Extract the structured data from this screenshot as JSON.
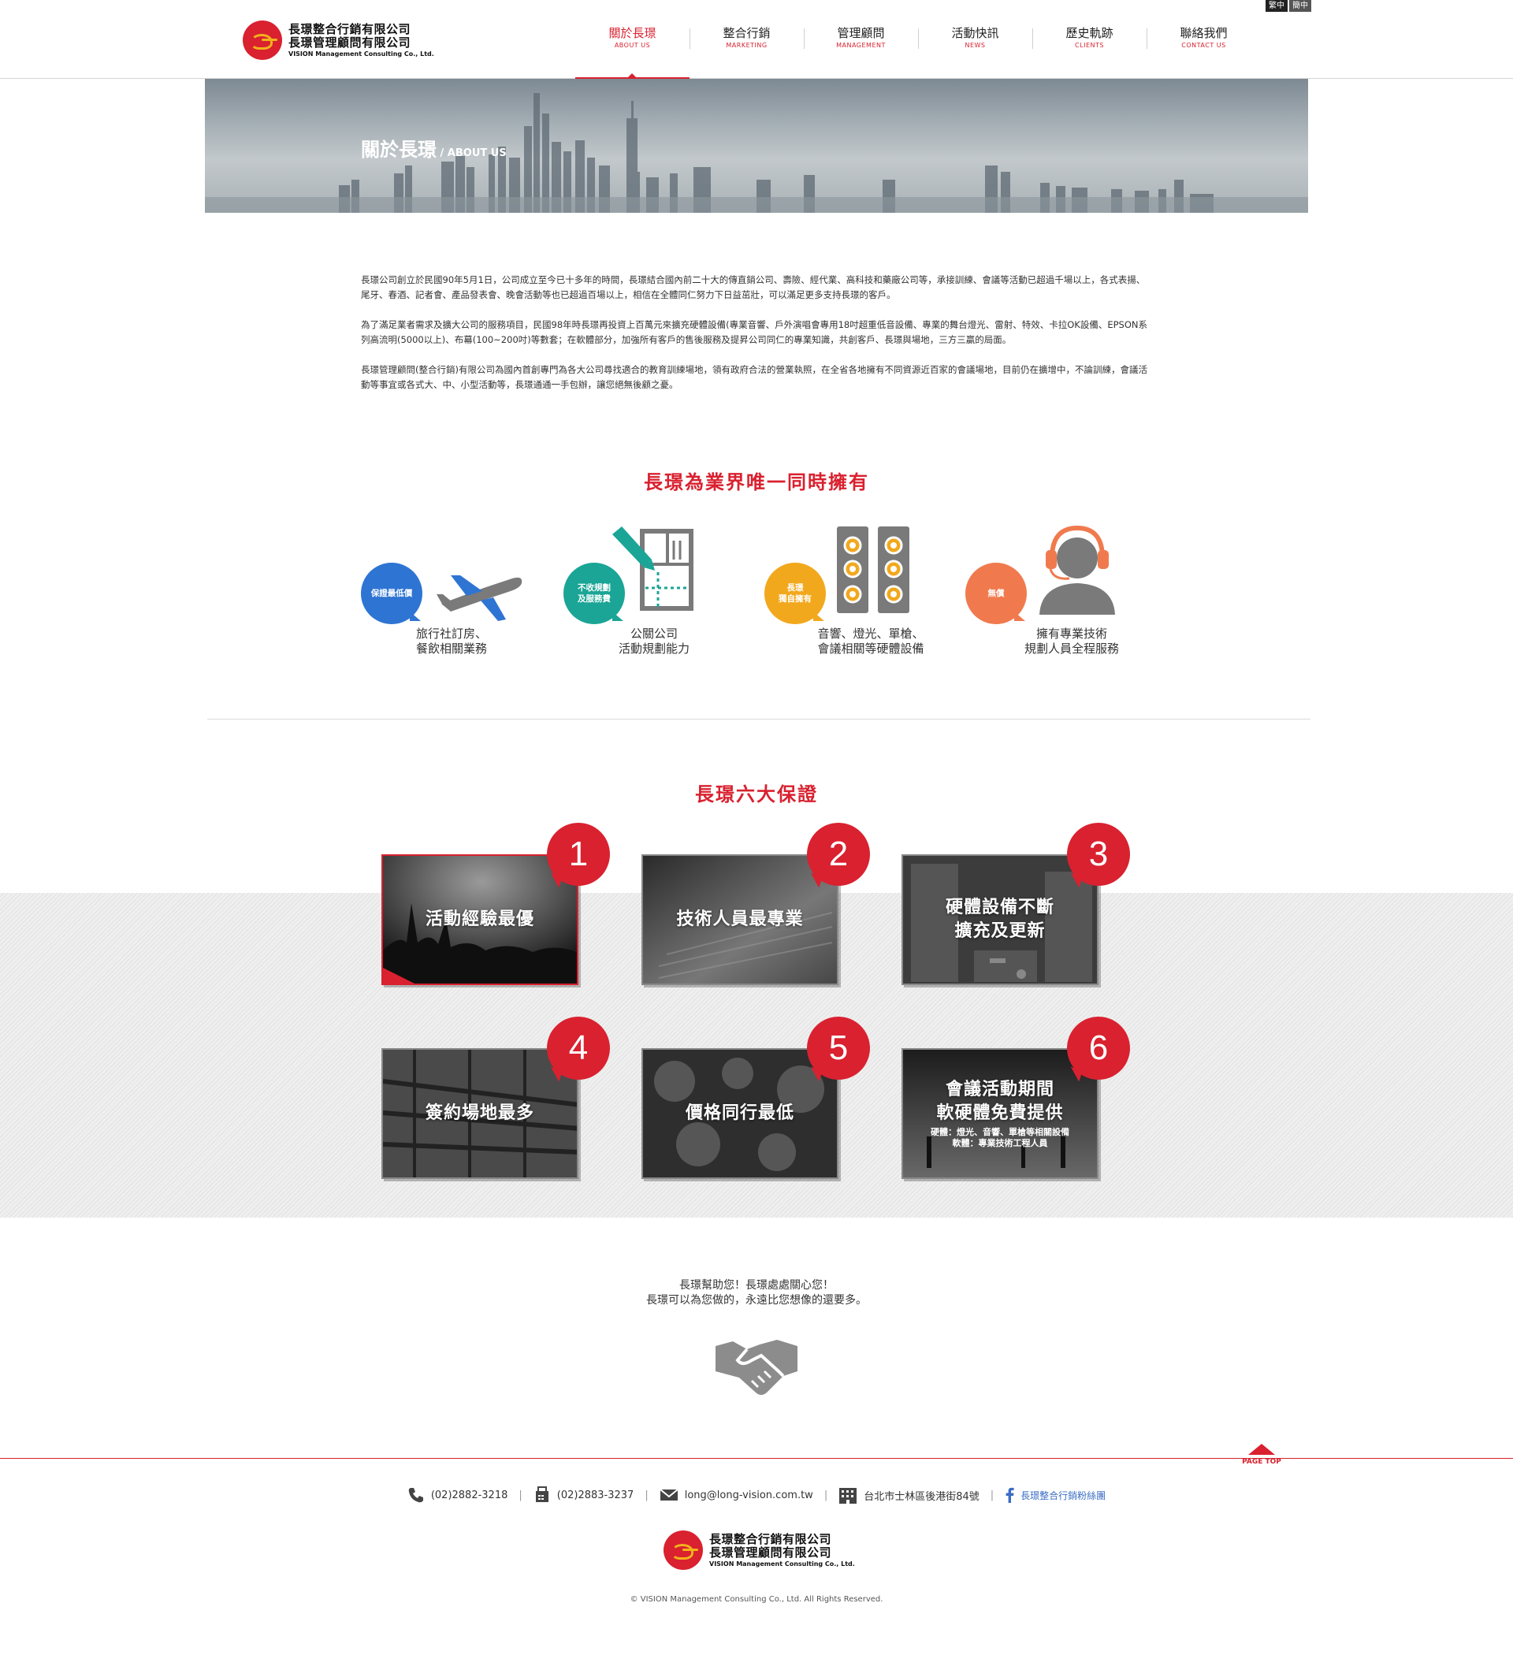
{
  "lang": [
    "繁中",
    "簡中"
  ],
  "logo": {
    "line1": "長璟整合行銷有限公司",
    "line2": "長璟管理顧問有限公司",
    "line3": "VISION Management Consulting Co., Ltd."
  },
  "nav": [
    {
      "zh": "關於長璟",
      "en": "ABOUT US"
    },
    {
      "zh": "整合行銷",
      "en": "MARKETING"
    },
    {
      "zh": "管理顧問",
      "en": "MANAGEMENT"
    },
    {
      "zh": "活動快訊",
      "en": "NEWS"
    },
    {
      "zh": "歷史軌跡",
      "en": "CLIENTS"
    },
    {
      "zh": "聯絡我們",
      "en": "CONTACT US"
    }
  ],
  "banner": {
    "zh": "關於長璟",
    "en": " / ABOUT US"
  },
  "intro": [
    "長璟公司創立於民國90年5月1日，公司成立至今已十多年的時間，長璟結合國內前二十大的傳直銷公司、壽險、經代業、高科技和藥廠公司等，承接訓練、會議等活動已超過千場以上，各式表揚、尾牙、春酒、記者會、產品發表會、晚會活動等也已超過百場以上，相信在全體同仁努力下日益茁壯，可以滿足更多支持長璟的客戶。",
    "為了滿足業者需求及擴大公司的服務項目，民國98年時長璟再投資上百萬元來擴充硬體設備(專業音響、戶外演唱會專用18吋超重低音設備、專業的舞台燈光、雷射、特效、卡拉OK設備、EPSON系列高流明(5000以上)、布幕(100~200吋)等數套；在軟體部分，加強所有客戶的售後服務及提昇公司同仁的專業知識，共創客戶、長璟與場地，三方三贏的局面。",
    "長璟管理顧問(整合行銷)有限公司為國內首創專門為各大公司尋找適合的教育訓練場地，領有政府合法的營業執照，在全省各地擁有不同資源近百家的會議場地，目前仍在擴增中，不論訓練，會議活動等事宜或各式大、中、小型活動等，長璟通通一手包辦，讓您絕無後顧之憂。"
  ],
  "features_title": "長璟為業界唯一同時擁有",
  "features": [
    {
      "badge_l1": "保證最低價",
      "badge_l2": "",
      "cap1": "旅行社訂房、",
      "cap2": "餐飲相關業務",
      "color": "#2e74d3",
      "icon": "airplane-icon"
    },
    {
      "badge_l1": "不收規劃",
      "badge_l2": "及服務費",
      "cap1": "公關公司",
      "cap2": "活動規劃能力",
      "color": "#1aa596",
      "icon": "floorplan-icon"
    },
    {
      "badge_l1": "長璟",
      "badge_l2": "獨自擁有",
      "cap1": "音響、燈光、單槍、",
      "cap2": "會議相關等硬體設備",
      "color": "#f2a81d",
      "icon": "speaker-icon"
    },
    {
      "badge_l1": "無償",
      "badge_l2": "",
      "cap1": "擁有專業技術",
      "cap2": "規劃人員全程服務",
      "color": "#f07a4e",
      "icon": "headset-person-icon"
    }
  ],
  "guarantee_title": "長璟六大保證",
  "guarantees": [
    {
      "num": "1",
      "title": "活動經驗最優",
      "title2": "",
      "sub1": "",
      "sub2": ""
    },
    {
      "num": "2",
      "title": "技術人員最專業",
      "title2": "",
      "sub1": "",
      "sub2": ""
    },
    {
      "num": "3",
      "title": "硬體設備不斷",
      "title2": "擴充及更新",
      "sub1": "",
      "sub2": ""
    },
    {
      "num": "4",
      "title": "簽約場地最多",
      "title2": "",
      "sub1": "",
      "sub2": ""
    },
    {
      "num": "5",
      "title": "價格同行最低",
      "title2": "",
      "sub1": "",
      "sub2": ""
    },
    {
      "num": "6",
      "title": "會議活動期間",
      "title2": "軟硬體免費提供",
      "sub1": "硬體：燈光、音響、單槍等相關設備",
      "sub2": "軟體：專業技術工程人員"
    }
  ],
  "closing": {
    "line1": "長璟幫助您！長璟處處關心您！",
    "line2": "長璟可以為您做的，永遠比您想像的還要多。"
  },
  "pagetop": "PAGE TOP",
  "contacts": {
    "phone": "(02)2882-3218",
    "fax": "(02)2883-3237",
    "email": "long@long-vision.com.tw",
    "address": "台北市士林區後港街84號",
    "facebook": "長璟整合行銷粉絲團"
  },
  "copyright": "© VISION Management Consulting Co., Ltd. All Rights Reserved.",
  "colors": {
    "accent": "#d9212f",
    "logo_gold": "#f2b21b"
  }
}
